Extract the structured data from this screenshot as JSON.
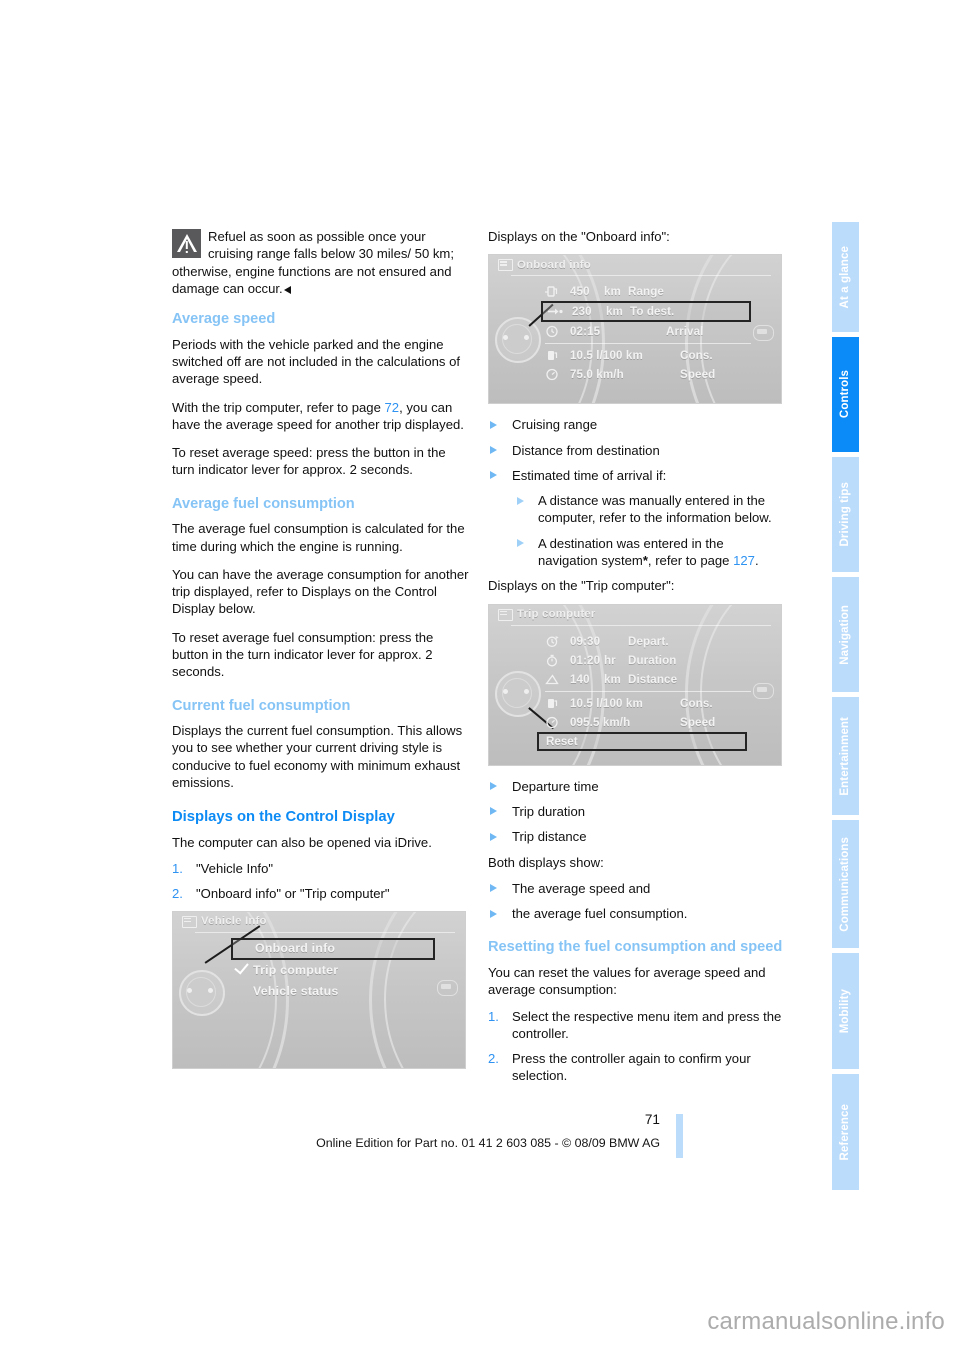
{
  "document": {
    "page_number": "71",
    "footer_note": "Online Edition for Part no. 01 41 2 603 085 - © 08/09 BMW AG",
    "watermark": "carmanualsonline.info"
  },
  "tabs": [
    {
      "label": "At a glance",
      "active": false
    },
    {
      "label": "Controls",
      "active": true
    },
    {
      "label": "Driving tips",
      "active": false
    },
    {
      "label": "Navigation",
      "active": false
    },
    {
      "label": "Entertainment",
      "active": false
    },
    {
      "label": "Communications",
      "active": false
    },
    {
      "label": "Mobility",
      "active": false
    },
    {
      "label": "Reference",
      "active": false
    }
  ],
  "left_column": {
    "warning": {
      "icon": "warning-triangle-icon",
      "text": "Refuel as soon as possible once your cruising range falls below 30 miles/ 50 km; otherwise, engine functions are not ensured and damage can occur."
    },
    "average_speed": {
      "heading": "Average speed",
      "p1": "Periods with the vehicle parked and the engine switched off are not included in the calculations of average speed.",
      "p2_before": "With the trip computer, refer to page ",
      "p2_ref": "72",
      "p2_after": ", you can have the average speed for another trip displayed.",
      "p3": "To reset average speed: press the button in the turn indicator lever for approx. 2 seconds."
    },
    "average_fuel_consumption": {
      "heading": "Average fuel consumption",
      "p1": "The average fuel consumption is calculated for the time during which the engine is running.",
      "p2": "You can have the average consumption for another trip displayed, refer to Displays on the Control Display below.",
      "p3": "To reset average fuel consumption: press the button in the turn indicator lever for approx. 2 seconds."
    },
    "current_fuel_consumption": {
      "heading": "Current fuel consumption",
      "p1": "Displays the current fuel consumption. This allows you to see whether your current driving style is conducive to fuel economy with minimum exhaust emissions."
    },
    "displays_on_control_display": {
      "heading": "Displays on the Control Display",
      "p1": "The computer can also be opened via iDrive.",
      "steps": [
        "\"Vehicle Info\"",
        "\"Onboard info\" or \"Trip computer\""
      ]
    },
    "vehicle_info_screen": {
      "title": "Vehicle Info",
      "items": [
        {
          "label": "Onboard info",
          "selected": true,
          "checked": false
        },
        {
          "label": "Trip computer",
          "selected": false,
          "checked": true
        },
        {
          "label": "Vehicle status",
          "selected": false,
          "checked": false
        }
      ]
    }
  },
  "right_column": {
    "onboard_intro": "Displays on the \"Onboard info\":",
    "onboard_screen": {
      "title": "Onboard info",
      "rows": [
        {
          "icon": "fuel-pump-range-icon",
          "value": "450",
          "unit": "km",
          "label": "Range",
          "selected": false
        },
        {
          "icon": "destination-arrow-icon",
          "value": "230",
          "unit": "km",
          "label": "To dest.",
          "selected": true
        },
        {
          "icon": "clock-arrival-icon",
          "value": "02:15",
          "unit": "",
          "label": "Arrival",
          "selected": false
        },
        {
          "icon": "fuel-pump-icon",
          "value": "10.5 l/100 km",
          "unit": "",
          "label": "Cons.",
          "selected": false,
          "wide": true
        },
        {
          "icon": "speedometer-icon",
          "value": "75.0 km/h",
          "unit": "",
          "label": "Speed",
          "selected": false,
          "wide": true
        }
      ]
    },
    "onboard_list": [
      "Cruising range",
      "Distance from destination",
      "Estimated time of arrival if:"
    ],
    "onboard_sublist": [
      {
        "text": "A distance was manually entered in the computer, refer to the information below."
      },
      {
        "text_before": "A destination was entered in the navigation system",
        "asterisk": "*",
        "text_mid": ", refer to page ",
        "ref": "127",
        "text_after": "."
      }
    ],
    "trip_intro": "Displays on the \"Trip computer\":",
    "trip_screen": {
      "title": "Trip computer",
      "rows": [
        {
          "icon": "clock-depart-icon",
          "value": "09:30",
          "unit": "",
          "label": "Depart."
        },
        {
          "icon": "stopwatch-icon",
          "value": "01:20",
          "unit": "hr",
          "label": "Duration"
        },
        {
          "icon": "distance-icon",
          "value": "140",
          "unit": "km",
          "label": "Distance"
        },
        {
          "icon": "fuel-pump-icon",
          "value": "10.5 l/100 km",
          "unit": "",
          "label": "Cons.",
          "wide": true
        },
        {
          "icon": "speedometer-icon",
          "value": "095.5 km/h",
          "unit": "",
          "label": "Speed",
          "wide": true
        }
      ],
      "reset_label": "Reset"
    },
    "trip_list": [
      "Departure time",
      "Trip duration",
      "Trip distance"
    ],
    "both_displays_intro": "Both displays show:",
    "both_displays_list": [
      "The average speed and",
      "the average fuel consumption."
    ],
    "resetting": {
      "heading": "Resetting the fuel consumption and speed",
      "p1": "You can reset the values for average speed and average consumption:",
      "steps": [
        "Select the respective menu item and press the controller.",
        "Press the controller again to confirm your selection."
      ]
    }
  },
  "colors": {
    "accent_blue": "#0d8bf5",
    "light_blue": "#86c4f6",
    "tab_inactive": "#bcdcfb",
    "tab_active": "#0b8bf7",
    "link_blue": "#2f93f2"
  }
}
